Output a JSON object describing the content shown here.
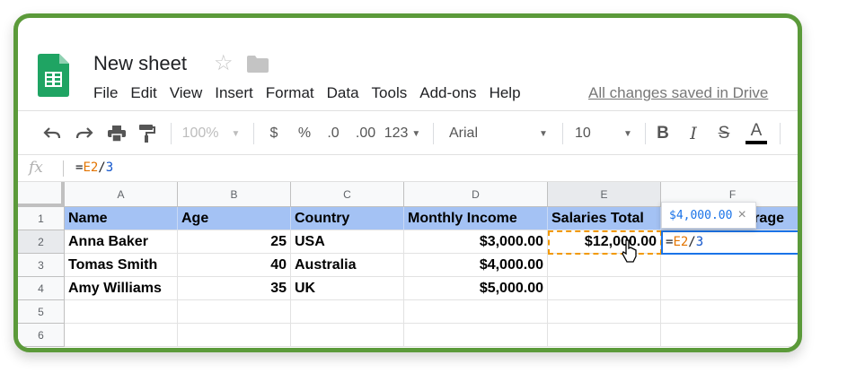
{
  "doc": {
    "title": "New sheet",
    "saved_status": "All changes saved in Drive"
  },
  "menu": [
    "File",
    "Edit",
    "View",
    "Insert",
    "Format",
    "Data",
    "Tools",
    "Add-ons",
    "Help"
  ],
  "toolbar": {
    "zoom": "100%",
    "currency": "$",
    "percent": "%",
    "decrease_decimal": ".0",
    "increase_decimal": ".00",
    "more_formats": "123",
    "font": "Arial",
    "font_size": "10",
    "bold": "B",
    "italic": "I",
    "strike": "S",
    "text_color": "A"
  },
  "formula_bar": {
    "fx": "fx",
    "formula_eq": "=",
    "formula_ref": "E2",
    "formula_op": "/",
    "formula_num": "3"
  },
  "grid": {
    "columns": [
      "A",
      "B",
      "C",
      "D",
      "E",
      "F"
    ],
    "rows": [
      "1",
      "2",
      "3",
      "4",
      "5",
      "6"
    ],
    "header": [
      "Name",
      "Age",
      "Country",
      "Monthly Income",
      "Salaries Total",
      "rage"
    ],
    "data": [
      [
        "Anna Baker",
        "25",
        "USA",
        "$3,000.00",
        "$12,000.00"
      ],
      [
        "Tomas Smith",
        "40",
        "Australia",
        "$4,000.00",
        ""
      ],
      [
        "Amy Williams",
        "35",
        "UK",
        "$5,000.00",
        ""
      ]
    ],
    "active_cell": {
      "eq": "=",
      "ref": "E2",
      "op": "/",
      "num": "3"
    },
    "preview_tooltip": {
      "value": "$4,000.00",
      "close": "×"
    }
  },
  "colors": {
    "frame": "#5b9a3a",
    "header_fill": "#a4c2f4",
    "active_border": "#1a73e8",
    "copy_marquee": "#f29900"
  },
  "icons": [
    "sheets-logo-icon",
    "star-icon",
    "folder-icon",
    "undo-icon",
    "redo-icon",
    "print-icon",
    "paint-format-icon",
    "cursor-icon"
  ]
}
